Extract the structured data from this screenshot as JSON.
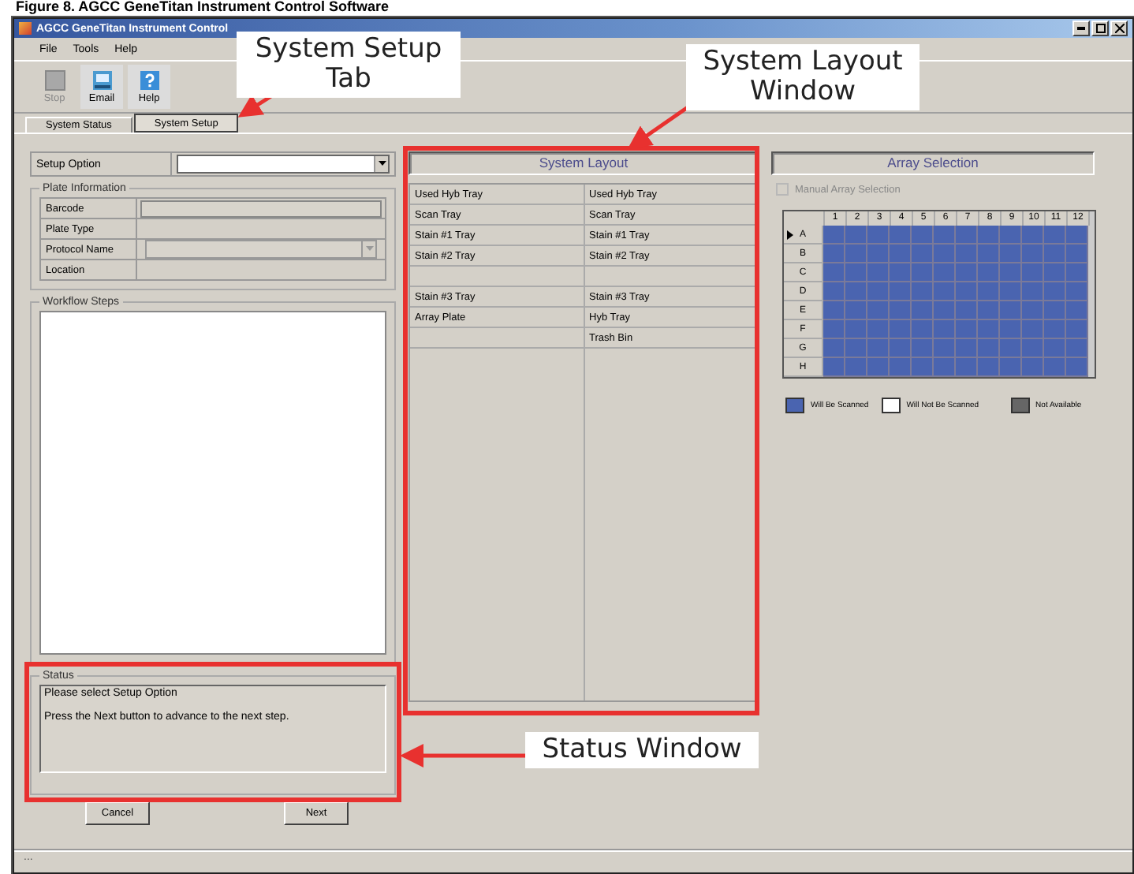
{
  "caption": "Figure 8. AGCC GeneTitan Instrument Control Software",
  "window": {
    "title": "AGCC GeneTitan Instrument Control"
  },
  "menu": [
    "File",
    "Tools",
    "Help"
  ],
  "toolbar": [
    {
      "label": "Stop",
      "kind": "stop",
      "disabled": true
    },
    {
      "label": "Email",
      "kind": "email",
      "disabled": false
    },
    {
      "label": "Help",
      "kind": "help",
      "disabled": false
    }
  ],
  "tabs": [
    {
      "label": "System Status",
      "selected": false
    },
    {
      "label": "System Setup",
      "selected": true
    }
  ],
  "setup_option": {
    "label": "Setup Option"
  },
  "plate_information": {
    "title": "Plate Information",
    "fields": [
      {
        "label": "Barcode",
        "kind": "text"
      },
      {
        "label": "Plate Type",
        "kind": "none"
      },
      {
        "label": "Protocol Name",
        "kind": "dropdown"
      },
      {
        "label": "Location",
        "kind": "none"
      }
    ]
  },
  "workflow_steps": {
    "title": "Workflow Steps"
  },
  "status": {
    "title": "Status",
    "lines": [
      "Please select Setup Option",
      "Press the Next button to advance to the next step."
    ]
  },
  "buttons": [
    "Cancel",
    "Next"
  ],
  "system_layout": {
    "title": "System Layout",
    "rows": [
      {
        "column_1": "Used Hyb Tray",
        "column_2": "Used Hyb Tray"
      },
      {
        "column_1": "Scan Tray",
        "column_2": "Scan Tray"
      },
      {
        "column_1": "Stain #1 Tray",
        "column_2": "Stain #1 Tray"
      },
      {
        "column_1": "Stain #2 Tray",
        "column_2": "Stain #2 Tray"
      },
      {},
      {
        "column_1": "Stain #3 Tray",
        "column_2": "Stain #3 Tray"
      },
      {
        "column_1": "Array Plate",
        "column_2": "Hyb Tray"
      },
      {
        "column_2": "Trash Bin"
      }
    ]
  },
  "array_selection": {
    "title": "Array Selection",
    "manual": {
      "label": "Manual Array Selection",
      "checked": false,
      "disabled": true
    },
    "columns": [
      "1",
      "2",
      "3",
      "4",
      "5",
      "6",
      "7",
      "8",
      "9",
      "10",
      "11",
      "12"
    ],
    "rows": [
      {
        "label": "A",
        "current": true,
        "scanned": true
      },
      {
        "label": "B",
        "current": false,
        "scanned": true
      },
      {
        "label": "C",
        "current": false,
        "scanned": true
      },
      {
        "label": "D",
        "current": false,
        "scanned": true
      },
      {
        "label": "E",
        "current": false,
        "scanned": true
      },
      {
        "label": "F",
        "current": false,
        "scanned": true
      },
      {
        "label": "G",
        "current": false,
        "scanned": true
      },
      {
        "label": "H",
        "current": false,
        "scanned": true
      }
    ],
    "legend": [
      {
        "label": "Will Be Scanned",
        "kind": "scanned",
        "color": "#4a64b0"
      },
      {
        "label": "Will Not Be Scanned",
        "kind": "not_scanned",
        "color": "#ffffff"
      },
      {
        "label": "Not Available",
        "kind": "unavailable",
        "color": "#666666"
      }
    ]
  },
  "status_bar": "...",
  "annotations": [
    "System Setup Tab",
    "System Layout Window",
    "Status Window"
  ]
}
